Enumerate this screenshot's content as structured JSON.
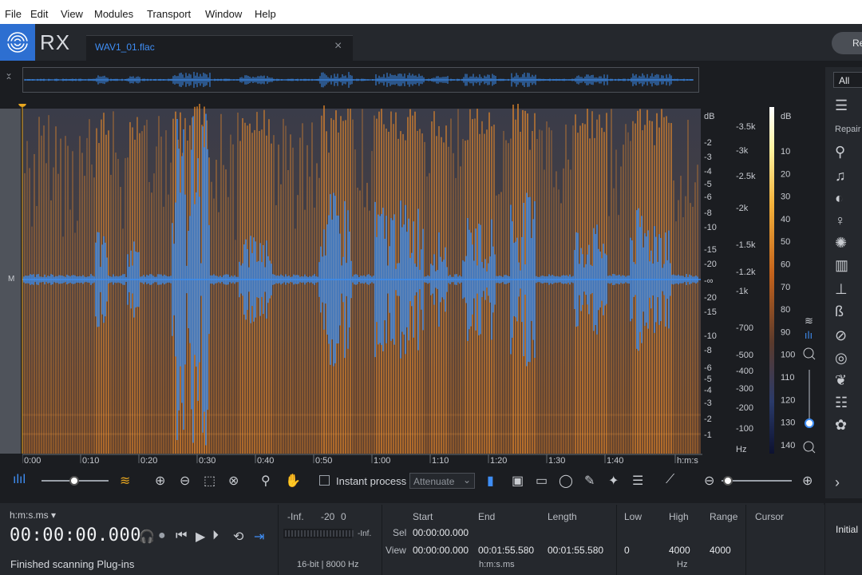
{
  "menu": [
    "File",
    "Edit",
    "View",
    "Modules",
    "Transport",
    "Window",
    "Help"
  ],
  "app": {
    "name": "RX",
    "file_tab": "WAV1_01.flac",
    "tab_close": "×",
    "right_button": "Re"
  },
  "channel_label": "M",
  "db_waveform_ticks": [
    "dB",
    "-2",
    "-3",
    "-4",
    "-5",
    "-6",
    "-8",
    "-10",
    "-15",
    "-20",
    "-∞",
    "-20",
    "-15",
    "-10",
    "-8",
    "-6",
    "-5",
    "-4",
    "-3",
    "-2",
    "-1"
  ],
  "hz_ticks": [
    "-3.5k",
    "-3k",
    "-2.5k",
    "-2k",
    "-1.5k",
    "-1.2k",
    "-1k",
    "-700",
    "-500",
    "-400",
    "-300",
    "-200",
    "-100",
    "Hz"
  ],
  "colorbar": {
    "title": "dB",
    "ticks": [
      "10",
      "20",
      "30",
      "40",
      "50",
      "60",
      "70",
      "80",
      "90",
      "100",
      "110",
      "120",
      "130",
      "140"
    ]
  },
  "time_ticks": [
    "0:00",
    "0:10",
    "0:20",
    "0:30",
    "0:40",
    "0:50",
    "1:00",
    "1:10",
    "1:20",
    "1:30",
    "1:40",
    "h:m:s"
  ],
  "toolbar": {
    "instant_process": "Instant process",
    "mode": "Attenuate"
  },
  "transport": {
    "format": "h:m:s.ms",
    "time": "00:00:00.000",
    "status": "Finished scanning Plug-ins"
  },
  "meter": {
    "labels": [
      "-Inf.",
      "-20",
      "0"
    ],
    "side": "-Inf.",
    "info": "16-bit | 8000 Hz"
  },
  "selection": {
    "headers": [
      "Start",
      "End",
      "Length"
    ],
    "rows": [
      {
        "label": "Sel",
        "start": "00:00:00.000",
        "end": "",
        "length": ""
      },
      {
        "label": "View",
        "start": "00:00:00.000",
        "end": "00:01:55.580",
        "length": "00:01:55.580"
      }
    ],
    "unit": "h:m:s.ms"
  },
  "freq": {
    "headers": [
      "Low",
      "High",
      "Range"
    ],
    "low": "0",
    "high": "4000",
    "range": "4000",
    "unit": "Hz"
  },
  "cursor": {
    "header": "Cursor"
  },
  "right_panel": {
    "filter": "All",
    "section": "Repair",
    "initial": "Initial"
  },
  "colors": {
    "accent": "#2d6fd1",
    "waveform": "#3b8df0",
    "spectrum_hot": "#e98a2a",
    "spectrum_bg": "#3f4150"
  }
}
